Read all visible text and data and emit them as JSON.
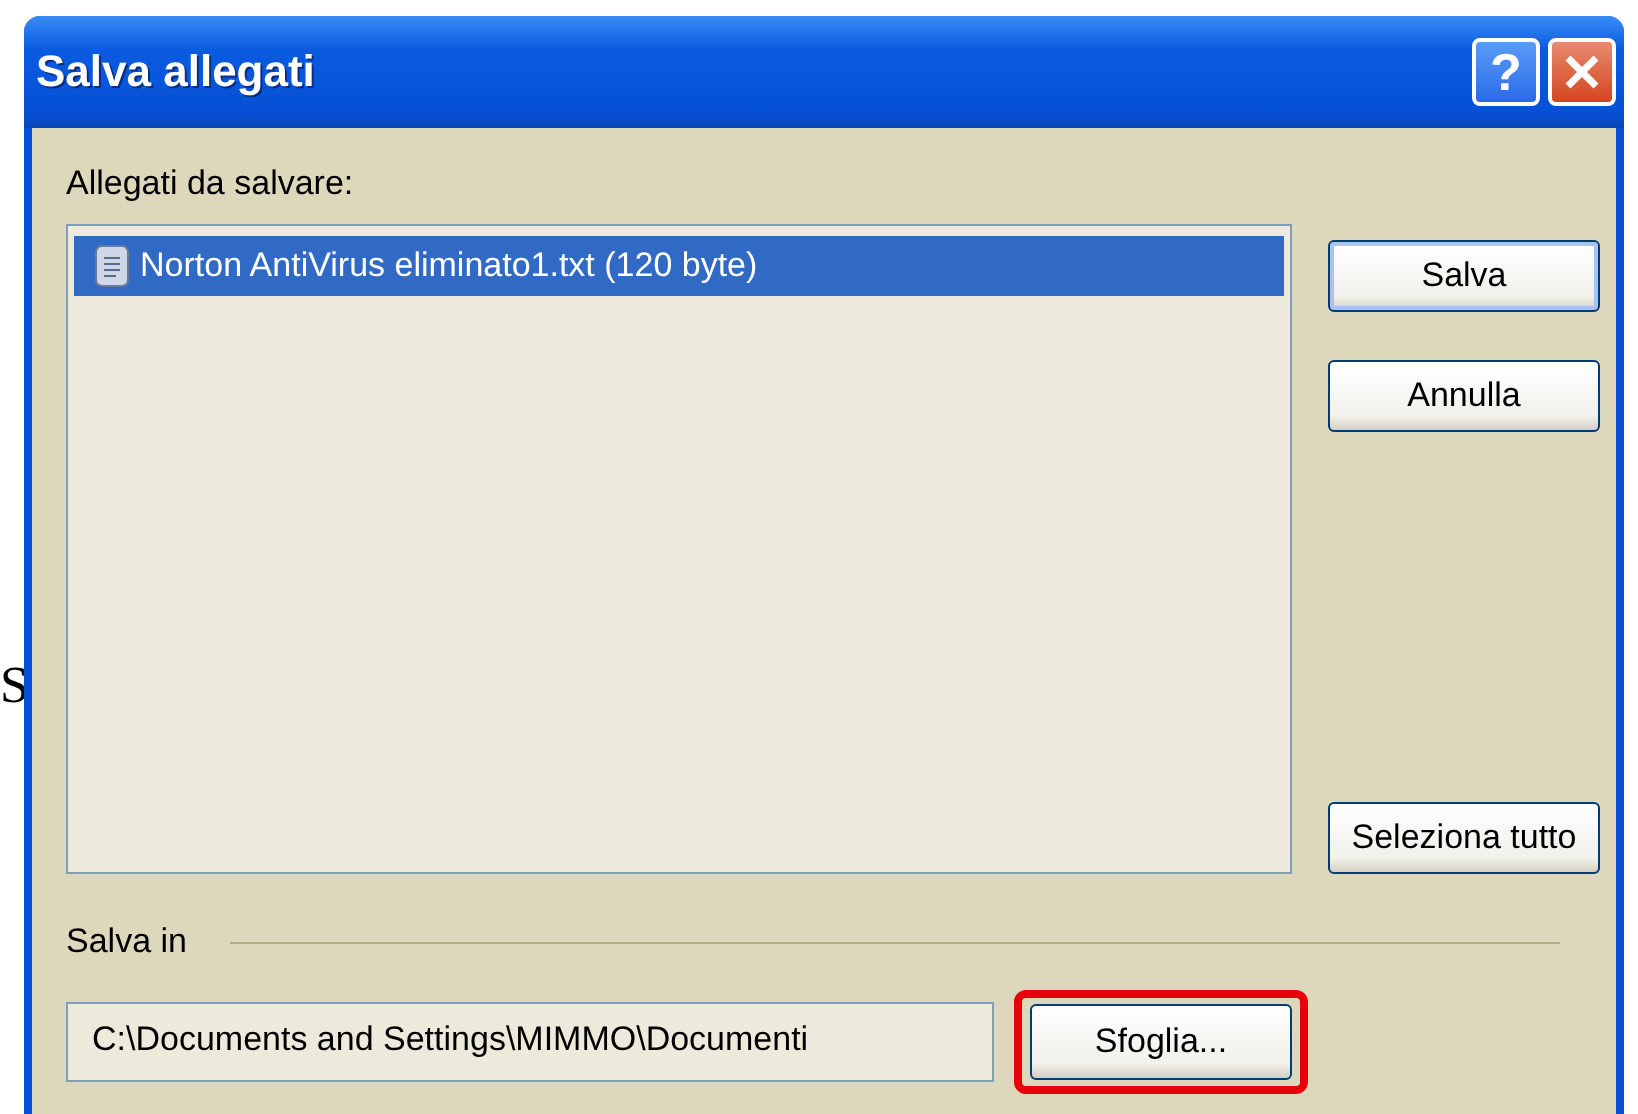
{
  "background_text": "S",
  "window": {
    "title": "Salva allegati",
    "title_buttons": [
      {
        "kind": "help",
        "label": "?"
      },
      {
        "kind": "close"
      }
    ]
  },
  "attachments": {
    "label": "Allegati da salvare:",
    "items": [
      {
        "name": "Norton AntiVirus eliminato1.txt (120 byte)",
        "selected": true
      }
    ]
  },
  "side_buttons": [
    {
      "label": "Salva",
      "default": true
    },
    {
      "label": "Annulla",
      "default": false
    },
    {
      "label": "Seleziona tutto",
      "default": false
    }
  ],
  "save_in": {
    "label": "Salva in",
    "path": "C:\\Documents and Settings\\MIMMO\\Documenti",
    "browse": {
      "label": "Sfoglia...",
      "highlighted": true
    }
  }
}
